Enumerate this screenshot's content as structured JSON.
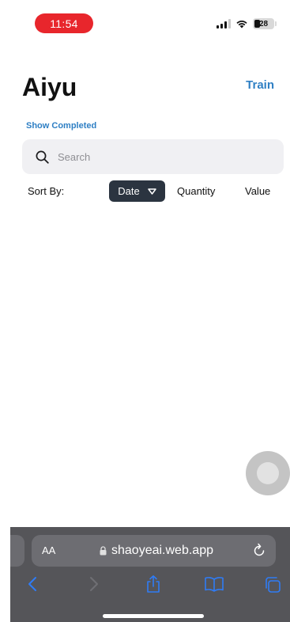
{
  "status_bar": {
    "time": "11:54",
    "battery": "28",
    "icons": [
      "signal-icon",
      "wifi-icon",
      "battery-icon"
    ]
  },
  "header": {
    "title": "Aiyu",
    "train_label": "Train",
    "show_completed_label": "Show Completed"
  },
  "search": {
    "placeholder": "Search",
    "value": ""
  },
  "sort": {
    "label": "Sort By:",
    "options": [
      "Date",
      "Quantity",
      "Value"
    ],
    "selected": "Date"
  },
  "browser": {
    "aa_label": "AA",
    "url": "shaoyeai.web.app"
  },
  "colors": {
    "accent": "#2e7fc4",
    "time_pill": "#e8262c",
    "sort_selected_bg": "#2b3440",
    "browser_bar": "#555559",
    "browser_icons": "#2f7cf6"
  }
}
